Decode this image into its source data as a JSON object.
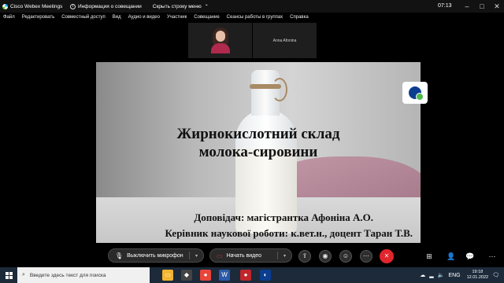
{
  "window": {
    "app_title": "Cisco Webex Meetings",
    "meeting_info": "Информация о совещании",
    "hide_menu": "Скрыть строку меню",
    "clock": "07:13"
  },
  "menu": [
    "Файл",
    "Редактировать",
    "Совместный доступ",
    "Вид",
    "Аудио и видео",
    "Участник",
    "Совещание",
    "Сеансы работы в группах",
    "Справка"
  ],
  "participants": {
    "self_video": "participant video",
    "other_name": "Anna Afonina"
  },
  "slide": {
    "title_line1": "Жирнокислотний склад",
    "title_line2": "молока-сировини",
    "reporter": "Доповідач: магістрантка Афоніна А.О.",
    "supervisor": "Керівник наукової роботи: к.вет.н., доцент Таран Т.В."
  },
  "controls": {
    "mute_label": "Выключить микрофон",
    "video_label": "Начать видео"
  },
  "taskbar": {
    "search_placeholder": "Введите здесь текст для поиска",
    "language": "ENG",
    "time": "19:18",
    "date": "12.01.2022"
  },
  "colors": {
    "end_call": "#e0262c",
    "taskbar": "#1c2a3a",
    "webex_blue": "#0b3d91"
  },
  "icons": [
    "webex-logo-icon",
    "info-icon",
    "chevron-down-icon",
    "minimize-icon",
    "maximize-icon",
    "close-icon",
    "microphone-icon",
    "camera-icon",
    "share-icon",
    "record-icon",
    "reactions-icon",
    "more-icon",
    "end-call-icon",
    "participants-icon",
    "chat-icon",
    "windows-start-icon",
    "search-icon"
  ]
}
